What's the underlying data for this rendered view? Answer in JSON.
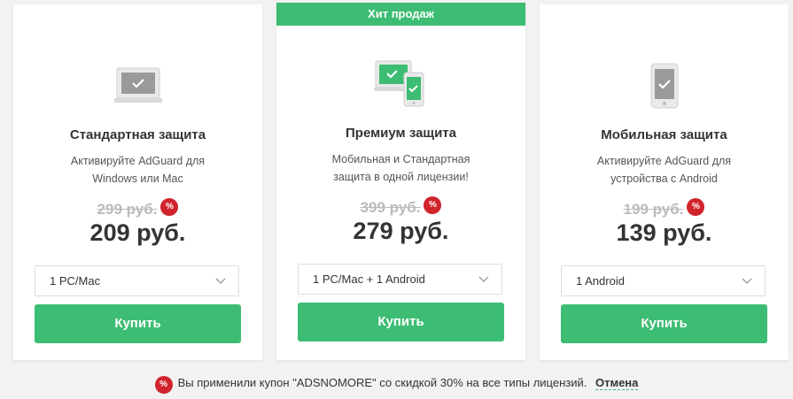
{
  "cards": [
    {
      "title": "Стандартная защита",
      "description": "Активируйте AdGuard для Windows или Mac",
      "old_price": "299 руб.",
      "new_price": "209 руб.",
      "select_value": "1 PC/Mac",
      "buy_label": "Купить",
      "badge": "%",
      "icon": "laptop-icon"
    },
    {
      "ribbon": "Хит продаж",
      "title": "Премиум защита",
      "description": "Мобильная и Стандартная защита в одной лицензии!",
      "old_price": "399 руб.",
      "new_price": "279 руб.",
      "select_value": "1 PC/Mac + 1 Android",
      "buy_label": "Купить",
      "badge": "%",
      "icon": "laptop-and-phone-icon"
    },
    {
      "title": "Мобильная защита",
      "description": "Активируйте AdGuard для устройства с Android",
      "old_price": "199 руб.",
      "new_price": "139 руб.",
      "select_value": "1 Android",
      "buy_label": "Купить",
      "badge": "%",
      "icon": "phone-icon"
    }
  ],
  "coupon": {
    "badge": "%",
    "text": "Вы применили купон \"ADSNOMORE\" со скидкой 30% на все типы лицензий.",
    "cancel_label": "Отмена"
  },
  "colors": {
    "accent": "#3dbd73",
    "discount_badge": "#d0232b",
    "device_gray": "#9a9a9a"
  }
}
